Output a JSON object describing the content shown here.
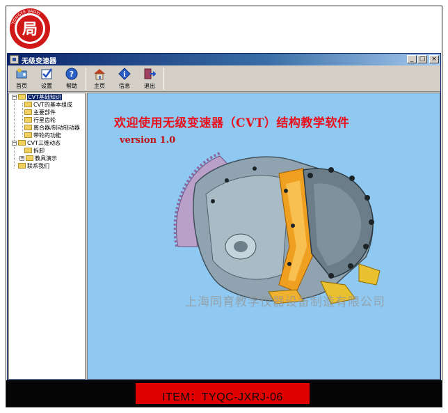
{
  "logo": {
    "text": "TONGYE JIAOYI",
    "sub": "同育教仪",
    "glyph": "局",
    "accent": "#d01818"
  },
  "window": {
    "title": "无级变速器",
    "buttons": {
      "minimize": "_",
      "maximize": "□",
      "close": "×"
    }
  },
  "toolbar": [
    {
      "label": "首页",
      "icon": "home-wizard-icon"
    },
    {
      "label": "设置",
      "icon": "checkbox-settings-icon"
    },
    {
      "label": "帮助",
      "icon": "help-icon"
    },
    {
      "label": "主页",
      "icon": "house-icon"
    },
    {
      "label": "信息",
      "icon": "info-icon"
    },
    {
      "label": "退出",
      "icon": "exit-icon"
    }
  ],
  "tree": {
    "root1": "CVT基础知识",
    "root1_children": [
      "CVT的基本组成",
      "主要部件",
      "行星齿轮",
      "离合器/制动制动器",
      "带轮的功能"
    ],
    "root2": "CVT三维动态",
    "root2_children": [
      "拆卸",
      "教具演示"
    ],
    "root3": "联系我们"
  },
  "main": {
    "headline": "欢迎使用无级变速器（CVT）结构教学软件",
    "version": "version 1.0",
    "watermark": "上海同育教学仪器设备制造有限公司",
    "background": "#8fc8f0",
    "headline_color": "#e8101c"
  },
  "footer": {
    "item": "ITEM：TYQC-JXRJ-06",
    "box_color": "#e00000"
  }
}
